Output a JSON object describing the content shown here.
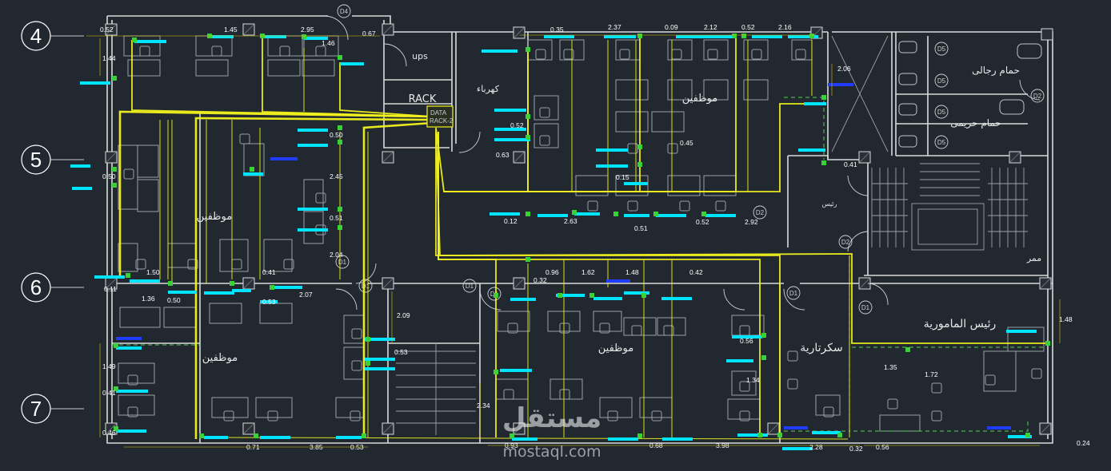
{
  "colors": {
    "background": "#212830",
    "wall": "#d9d9d9",
    "furniture": "#9aa0a6",
    "cable": "#f2f21e",
    "cable_core": "#ffff55",
    "outlet_cyan": "#00e5ff",
    "outlet_blue": "#1f3cff",
    "node_green": "#38d238",
    "dim_yellow": "#e0c400",
    "dashed_green": "#58d058"
  },
  "grid_labels": [
    "4",
    "5",
    "6",
    "7"
  ],
  "rooms": {
    "ups": "ups",
    "rack": "RACK",
    "electricity": "كهرباء",
    "employees_top": "موظفين",
    "employees_left": "موظفين",
    "employees_bottom_left": "موظفين",
    "employees_center": "موظفين",
    "secretary": "سكرتارية",
    "manager": "رئيس المامورية",
    "corridor": "ممر",
    "mens_wc": "حمام رجالى",
    "womens_wc": "حمام حريمى",
    "small_office": "رئيس"
  },
  "data_rack": {
    "line1": "DATA",
    "line2": "RACK-2"
  },
  "door_tags": [
    "D4",
    "D2",
    "D2",
    "D2",
    "D1",
    "D1",
    "D1",
    "D1",
    "D1",
    "D1",
    "D5",
    "D5",
    "D5",
    "D5"
  ],
  "dimensions": {
    "top": [
      "0.52",
      "1.45",
      "2.95",
      "1.46",
      "0.67",
      "0.35",
      "2.37",
      "0.09",
      "2.12",
      "0.52",
      "2.16"
    ],
    "right_top": [
      "2.06",
      "0.41"
    ],
    "left": [
      "1.44",
      "0.50",
      "1.50",
      "0.11",
      "1.36",
      "0.50",
      "1.49",
      "0.41",
      "0.46"
    ],
    "middle": [
      "0.50",
      "2.45",
      "0.51",
      "2.04",
      "0.41",
      "0.53",
      "2.07",
      "0.52",
      "0.63",
      "0.45",
      "0.15",
      "0.12",
      "2.63",
      "0.51",
      "0.52",
      "2.92"
    ],
    "center": [
      "0.96",
      "0.32",
      "1.62",
      "1.48",
      "0.42",
      "2.09",
      "0.53",
      "0.56",
      "1.34",
      "2.34"
    ],
    "right": [
      "1.48",
      "1.35",
      "1.72"
    ],
    "bottom": [
      "0.71",
      "3.85",
      "0.53",
      "0.93",
      "0.68",
      "3.98",
      "2.28",
      "0.32",
      "0.56",
      "0.24"
    ]
  },
  "watermark": {
    "arabic": "مستقل",
    "latin": "mostaql.com"
  }
}
